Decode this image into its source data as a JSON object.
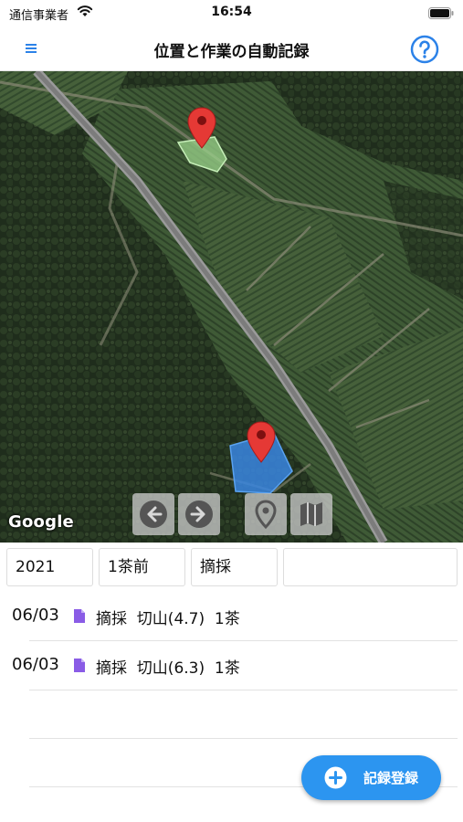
{
  "status_bar": {
    "carrier": "通信事業者",
    "time": "16:54"
  },
  "nav": {
    "title": "位置と作業の自動記録",
    "menu_icon": "hamburger-menu-icon",
    "help_icon": "question-circle-icon"
  },
  "map": {
    "attribution": "Google",
    "controls": [
      "arrow-left-icon",
      "arrow-right-icon",
      "map-pin-icon",
      "folded-map-icon"
    ],
    "field_colors": {
      "upper_field": "#9ad28a",
      "lower_field": "#3a86e0",
      "marker": "#e53935"
    }
  },
  "filters": {
    "year": "2021",
    "season": "1茶前",
    "work": "摘採",
    "extra": ""
  },
  "records": [
    {
      "date": "06/03",
      "description": "摘採  切山(4.7)  1茶"
    },
    {
      "date": "06/03",
      "description": "摘採  切山(6.3)  1茶"
    }
  ],
  "fab": {
    "label": "記録登録",
    "color": "#2c95f0"
  },
  "colors": {
    "accent": "#2c95f0",
    "doc_icon": "#8a5ce6"
  }
}
